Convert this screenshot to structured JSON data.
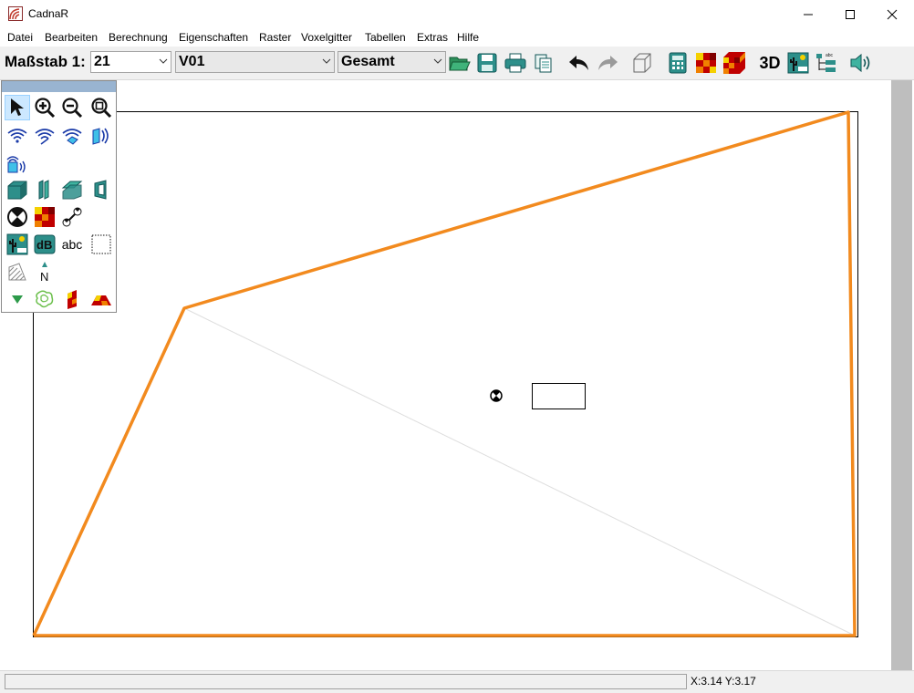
{
  "window": {
    "title": "CadnaR"
  },
  "menu": [
    "Datei",
    "Bearbeiten",
    "Berechnung",
    "Eigenschaften",
    "Raster",
    "Voxelgitter",
    "Tabellen",
    "Extras",
    "Hilfe"
  ],
  "toolbar": {
    "scale_label": "Maßstab 1:",
    "scale_value": "21",
    "variant_value": "V01",
    "mode_value": "Gesamt",
    "three_d_label": "3D"
  },
  "palette": {
    "text_tool_label": "abc",
    "north_label": "N"
  },
  "status": {
    "text": "",
    "coords": "X:3.14 Y:3.17"
  },
  "colors": {
    "outline": "#f28a1e",
    "selection": "#cce8ff",
    "palette_header": "#99b4d1"
  }
}
